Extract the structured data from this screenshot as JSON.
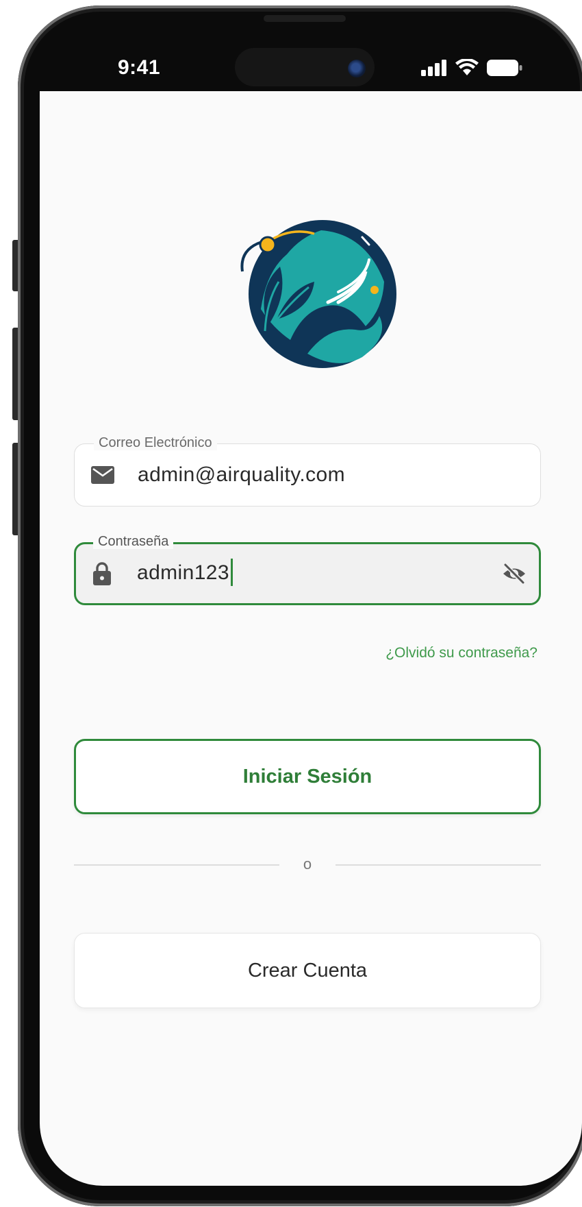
{
  "status_bar": {
    "time": "9:41",
    "icons": [
      "cellular-signal-icon",
      "wifi-icon",
      "battery-icon"
    ]
  },
  "logo": {
    "icon": "earth-leaf-air-logo",
    "colors": {
      "navy": "#0f3557",
      "teal": "#1fa7a4",
      "accent": "#f5b51c"
    }
  },
  "login_form": {
    "email": {
      "label": "Correo Electrónico",
      "value": "admin@airquality.com",
      "icon": "mail-icon"
    },
    "password": {
      "label": "Contraseña",
      "value": "admin123",
      "icon": "lock-icon",
      "toggle_icon": "eye-off-icon"
    },
    "forgot_password": "¿Olvidó su contraseña?",
    "submit_label": "Iniciar Sesión",
    "divider_text": "o",
    "create_account_label": "Crear Cuenta"
  },
  "colors": {
    "accent": "#2f8a3b",
    "background": "#fafafa",
    "text": "#2a2a2a"
  }
}
